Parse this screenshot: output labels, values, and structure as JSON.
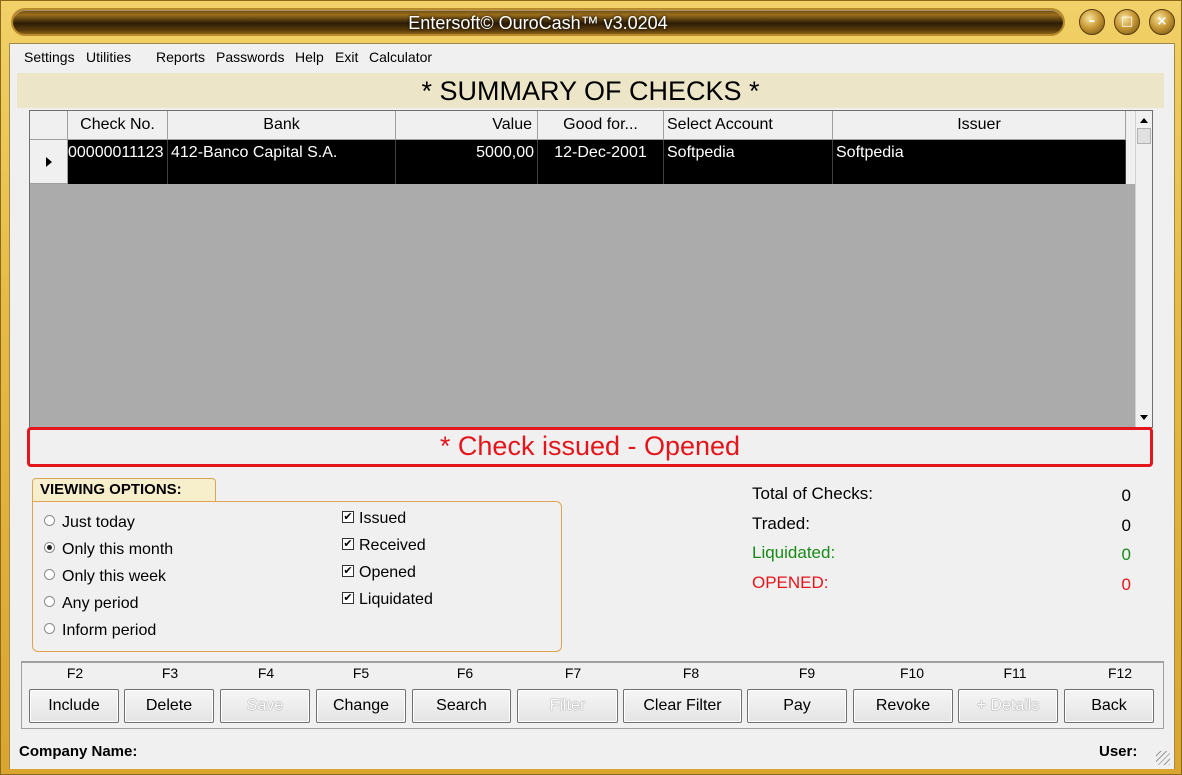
{
  "window": {
    "title": "Entersoft© OuroCash™ v3.0204",
    "buttons": [
      "minimize-icon",
      "restore-icon",
      "close-icon"
    ]
  },
  "menu": {
    "items": [
      "Settings",
      "Utilities",
      "Reports",
      "Passwords",
      "Help",
      "Exit",
      "Calculator"
    ]
  },
  "summary_title": "* SUMMARY OF CHECKS *",
  "grid": {
    "columns": [
      "Check No.",
      "Bank",
      "Value",
      "Good for...",
      "Select Account",
      "Issuer"
    ],
    "rows": [
      {
        "check_no": "00000011123",
        "bank": "412-Banco Capital S.A.",
        "value": "5000,00",
        "good_for": "12-Dec-2001",
        "account": "Softpedia",
        "issuer": "Softpedia"
      }
    ]
  },
  "status_text": "* Check issued - Opened",
  "viewing_options": {
    "title": "VIEWING OPTIONS:",
    "periods": [
      {
        "label": "Just today",
        "selected": false
      },
      {
        "label": "Only this month",
        "selected": true
      },
      {
        "label": "Only this week",
        "selected": false
      },
      {
        "label": "Any period",
        "selected": false
      },
      {
        "label": "Inform period",
        "selected": false
      }
    ],
    "filters": [
      {
        "label": "Issued",
        "checked": true
      },
      {
        "label": "Received",
        "checked": true
      },
      {
        "label": "Opened",
        "checked": true
      },
      {
        "label": "Liquidated",
        "checked": true
      }
    ]
  },
  "totals": [
    {
      "label": "Total of Checks:",
      "value": "0",
      "color": "#000000"
    },
    {
      "label": "Traded:",
      "value": "0",
      "color": "#000000"
    },
    {
      "label": "Liquidated:",
      "value": "0",
      "color": "#178a17"
    },
    {
      "label": "OPENED:",
      "value": "0",
      "color": "#e4151b"
    }
  ],
  "function_keys": [
    {
      "key": "F2",
      "label": "Include",
      "enabled": true
    },
    {
      "key": "F3",
      "label": "Delete",
      "enabled": true
    },
    {
      "key": "F4",
      "label": "Save",
      "enabled": false
    },
    {
      "key": "F5",
      "label": "Change",
      "enabled": true
    },
    {
      "key": "F6",
      "label": "Search",
      "enabled": true
    },
    {
      "key": "F7",
      "label": "Filter",
      "enabled": false
    },
    {
      "key": "F8",
      "label": "Clear Filter",
      "enabled": true
    },
    {
      "key": "F9",
      "label": "Pay",
      "enabled": true
    },
    {
      "key": "F10",
      "label": "Revoke",
      "enabled": true
    },
    {
      "key": "F11",
      "label": "+ Details",
      "enabled": false
    },
    {
      "key": "F12",
      "label": "Back",
      "enabled": true
    }
  ],
  "footer": {
    "company_label": "Company Name:",
    "user_label": "User:"
  }
}
